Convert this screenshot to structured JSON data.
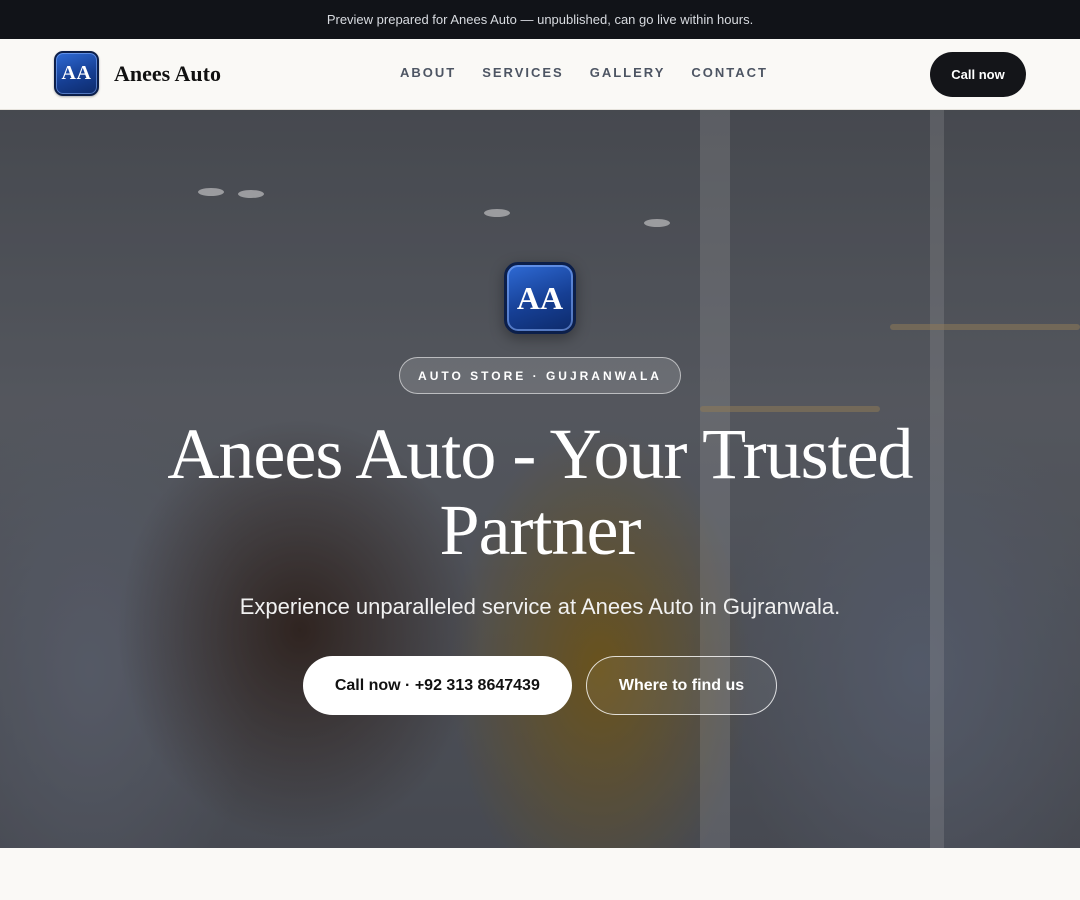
{
  "topbar": {
    "notice": "Preview prepared for Anees Auto — unpublished, can go live within hours."
  },
  "nav": {
    "logo_text": "AA",
    "brand_name": "Anees Auto",
    "links": [
      "ABOUT",
      "SERVICES",
      "GALLERY",
      "CONTACT"
    ],
    "cta_label": "Call now"
  },
  "hero": {
    "logo_text": "AA",
    "badge": "AUTO STORE · GUJRANWALA",
    "title": "Anees Auto - Your Trusted Partner",
    "subtitle": "Experience unparalleled service at Anees Auto in Gujranwala.",
    "primary_button": "Call now · +92 313 8647439",
    "secondary_button": "Where to find us"
  },
  "colors": {
    "topbar_bg": "#111318",
    "logo_blue": "#163f94",
    "cta_dark": "#141519",
    "page_bg": "#faf9f6"
  }
}
